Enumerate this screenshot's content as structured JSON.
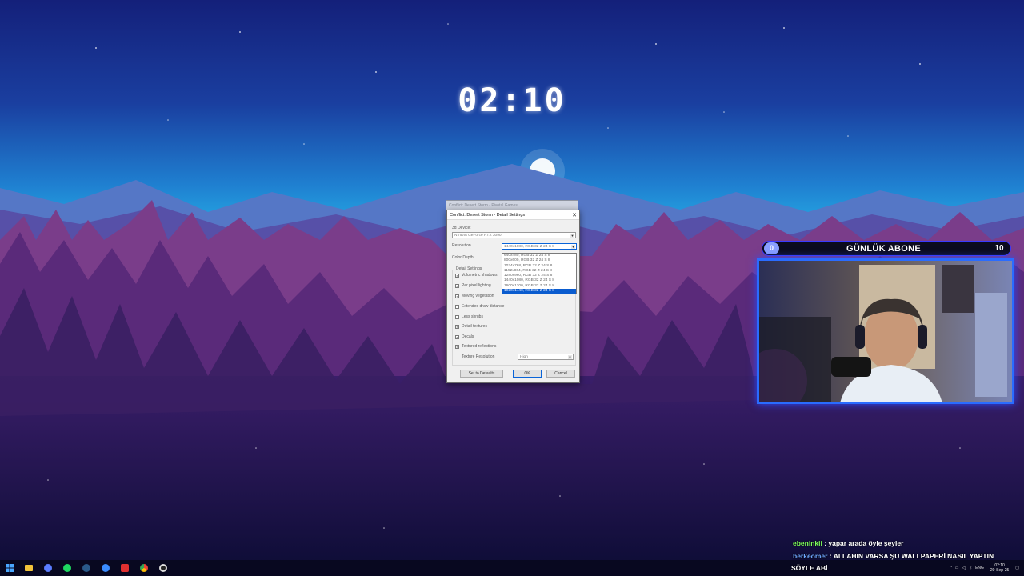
{
  "clock": {
    "time": "02:10"
  },
  "dialog": {
    "background_window_title": "Conflict: Desert Storm - Pivotal Games",
    "title": "Conflict: Desert Storm - Detail Settings",
    "device_label": "3d Device:",
    "device_value": "NVIDIA GeForce RTX 3090",
    "resolution_label": "Resolution",
    "resolution_value": "1440x1080, RGB 32 Z 24 S 8",
    "color_depth_label": "Color Depth",
    "detail_settings_label": "Detail Settings",
    "resolution_options": [
      "640x480, RGB 32 Z 24 S 8",
      "800x600, RGB 32 Z 24 S 8",
      "1024x768, RGB 32 Z 24 S 8",
      "1152x864, RGB 32 Z 24 S 8",
      "1280x960, RGB 32 Z 24 S 8",
      "1440x1080, RGB 32 Z 24 S 8",
      "1600x1200, RGB 32 Z 24 S 8",
      "1920x1440, RGB 32 Z 24 S 8"
    ],
    "selected_resolution_index": 7,
    "checkboxes": [
      {
        "label": "Volumetric shadows",
        "checked": true
      },
      {
        "label": "Per pixel lighting",
        "checked": true
      },
      {
        "label": "Moving vegetation",
        "checked": true
      },
      {
        "label": "Extended draw distance",
        "checked": false
      },
      {
        "label": "Less shrubs",
        "checked": false
      },
      {
        "label": "Detail textures",
        "checked": true
      },
      {
        "label": "Decals",
        "checked": true
      },
      {
        "label": "Textured reflections",
        "checked": true
      }
    ],
    "texture_resolution_label": "Texture Resolution",
    "texture_resolution_value": "High",
    "defaults_button": "Set to Defaults",
    "ok_button": "OK",
    "cancel_button": "Cancel"
  },
  "overlay": {
    "sub_count": "0",
    "sub_title": "GÜNLÜK ABONE",
    "sub_goal": "10"
  },
  "chat": [
    {
      "user": "ebeninkii",
      "user_color": "#7dff5a",
      "message": " : yapar arada öyle şeyler"
    },
    {
      "user": "berkeomer",
      "user_color": "#6fa8ff",
      "message": " : ALLAHIN VARSA ŞU WALLPAPERİ NASIL YAPTIN"
    },
    {
      "user": "",
      "user_color": "#ffffff",
      "message": "SÖYLE ABİ"
    }
  ],
  "taskbar": {
    "language": "ENG",
    "time": "02:10",
    "date": "20-Sep-25",
    "icons": [
      "windows-start-icon",
      "file-explorer-icon",
      "browser-icon",
      "spotify-icon",
      "steam-icon",
      "app-blue-icon",
      "app-red-icon",
      "chrome-icon",
      "obs-icon"
    ]
  }
}
